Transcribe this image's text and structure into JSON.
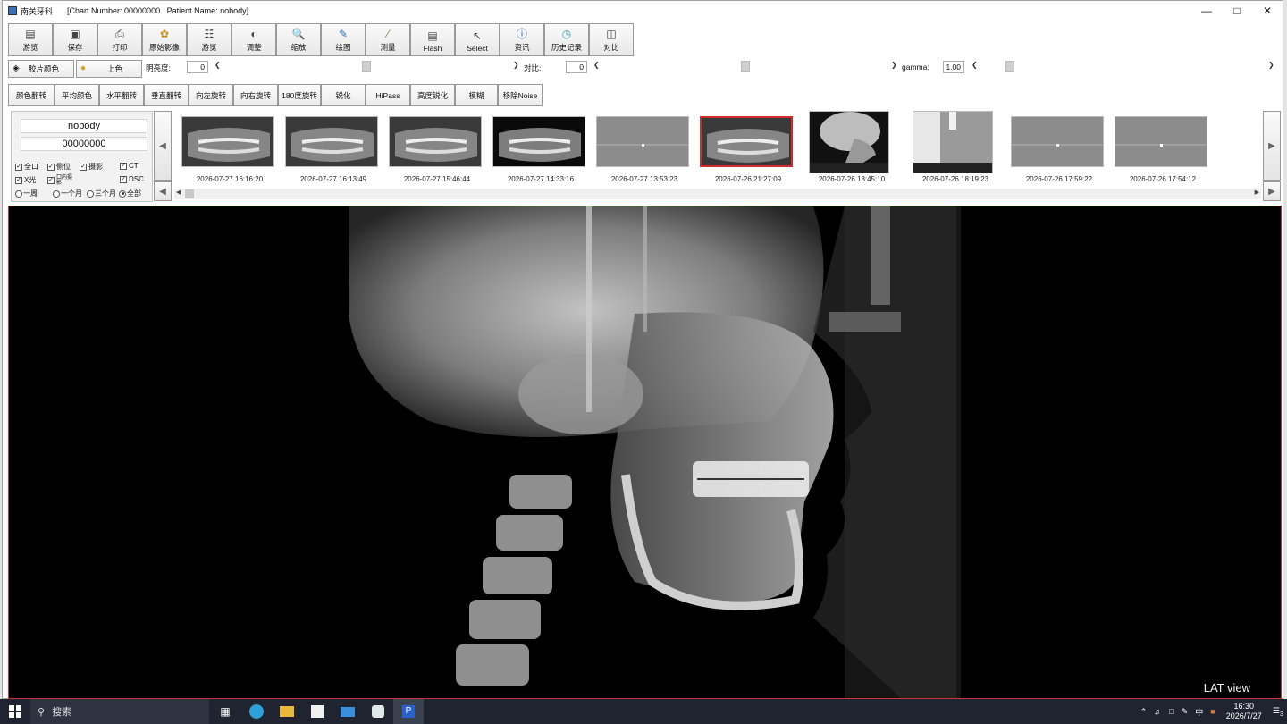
{
  "window": {
    "app_name": "南关牙科",
    "title_info": "[Chart Number: 00000000   Patient Name: nobody]"
  },
  "toolbar": [
    {
      "label": "游览",
      "icon": "browse-icon"
    },
    {
      "label": "保存",
      "icon": "save-icon"
    },
    {
      "label": "打印",
      "icon": "print-icon"
    },
    {
      "label": "原始影像",
      "icon": "original-image-icon"
    },
    {
      "label": "游览",
      "icon": "browse-list-icon"
    },
    {
      "label": "调整",
      "icon": "adjust-icon"
    },
    {
      "label": "缩放",
      "icon": "zoom-icon"
    },
    {
      "label": "绘图",
      "icon": "draw-icon"
    },
    {
      "label": "测量",
      "icon": "measure-icon"
    },
    {
      "label": "Flash",
      "icon": "flash-icon"
    },
    {
      "label": "Select",
      "icon": "cursor-icon"
    },
    {
      "label": "资讯",
      "icon": "info-icon"
    },
    {
      "label": "历史记录",
      "icon": "history-icon"
    },
    {
      "label": "对比",
      "icon": "compare-icon"
    }
  ],
  "adjust": {
    "film_color": "胶片颜色",
    "color_up": "上色",
    "brightness_label": "明亮度:",
    "brightness_value": "0",
    "contrast_label": "对比:",
    "contrast_value": "0",
    "gamma_label": "gamma:",
    "gamma_value": "1.00"
  },
  "ops": [
    "颜色翻转",
    "平均颜色",
    "水平翻转",
    "垂直翻转",
    "向左旋转",
    "向右旋转",
    "180度旋转",
    "锐化",
    "HiPass",
    "高度锐化",
    "模糊",
    "移除Noise"
  ],
  "patient": {
    "name": "nobody",
    "chart_number": "00000000",
    "filters": [
      {
        "label": "全口",
        "checked": true
      },
      {
        "label": "侧位",
        "checked": true
      },
      {
        "label": "摄影",
        "checked": true
      },
      {
        "label": "CT",
        "checked": true
      },
      {
        "label": "X光",
        "checked": true
      },
      {
        "label": "口内摄影",
        "checked": true
      },
      {
        "label": "DSC",
        "checked": true
      }
    ],
    "ranges": [
      {
        "label": "一周",
        "selected": false
      },
      {
        "label": "一个月",
        "selected": false
      },
      {
        "label": "三个月",
        "selected": false
      },
      {
        "label": "全部",
        "selected": true
      }
    ]
  },
  "thumbnails": [
    {
      "date": "2026-07-27 16:16:20",
      "kind": "panoramic"
    },
    {
      "date": "2026-07-27 16:13:49",
      "kind": "panoramic"
    },
    {
      "date": "2026-07-27 15:46:44",
      "kind": "panoramic"
    },
    {
      "date": "2026-07-27 14:33:16",
      "kind": "panoramic-dark"
    },
    {
      "date": "2026-07-27 13:53:23",
      "kind": "gray"
    },
    {
      "date": "2026-07-26 21:27:09",
      "kind": "panoramic",
      "selected": true
    },
    {
      "date": "2026-07-26 18:45:10",
      "kind": "cephalometric"
    },
    {
      "date": "2026-07-26 18:19:23",
      "kind": "calibration"
    },
    {
      "date": "2026-07-26 17:59:22",
      "kind": "gray"
    },
    {
      "date": "2026-07-26 17:54:12",
      "kind": "gray"
    }
  ],
  "viewer": {
    "view_label": "LAT view"
  },
  "taskbar": {
    "search_placeholder": "搜索",
    "ime": "中",
    "time": "16:30",
    "date": "2026/7/27",
    "notification_count": "3"
  }
}
